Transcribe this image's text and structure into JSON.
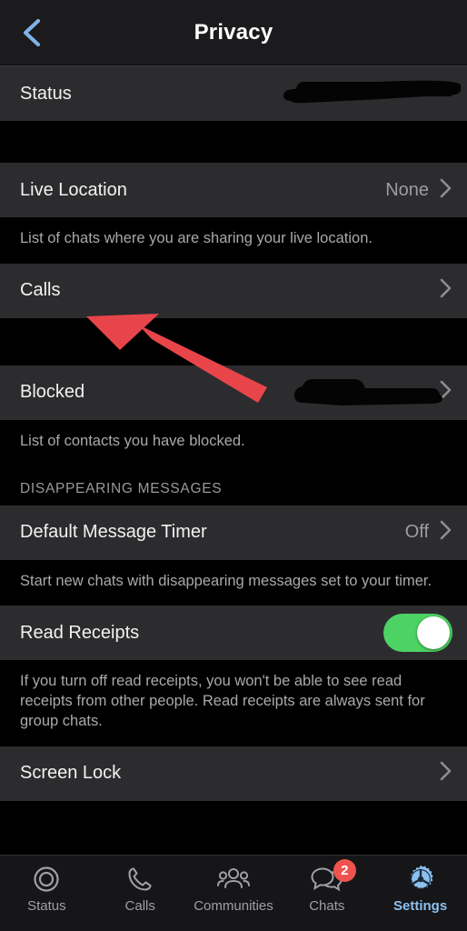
{
  "header": {
    "title": "Privacy",
    "back_icon": "chevron-left-icon",
    "accent_color": "#7fb3e8"
  },
  "colors": {
    "row_bg": "#2c2c2e",
    "page_bg": "#000000",
    "toggle_on": "#4cd364",
    "badge": "#ef5350",
    "active_tab": "#8cc0f0",
    "annotation_arrow": "#e8454b"
  },
  "sections": [
    {
      "header": null,
      "rows": [
        {
          "label": "Status",
          "value": "",
          "redacted": true,
          "chevron": false,
          "toggle": null
        }
      ],
      "footer": null
    },
    {
      "header": null,
      "rows": [
        {
          "label": "Live Location",
          "value": "None",
          "redacted": false,
          "chevron": true,
          "toggle": null
        }
      ],
      "footer": "List of chats where you are sharing your live location."
    },
    {
      "header": null,
      "rows": [
        {
          "label": "Calls",
          "value": "",
          "redacted": false,
          "chevron": true,
          "toggle": null
        }
      ],
      "footer": null
    },
    {
      "header": null,
      "rows": [
        {
          "label": "Blocked",
          "value": "",
          "redacted": true,
          "chevron": true,
          "toggle": null
        }
      ],
      "footer": "List of contacts you have blocked."
    },
    {
      "header": "DISAPPEARING MESSAGES",
      "rows": [
        {
          "label": "Default Message Timer",
          "value": "Off",
          "redacted": false,
          "chevron": true,
          "toggle": null
        }
      ],
      "footer": "Start new chats with disappearing messages set to your timer."
    },
    {
      "header": null,
      "rows": [
        {
          "label": "Read Receipts",
          "value": "",
          "redacted": false,
          "chevron": false,
          "toggle": "on"
        }
      ],
      "footer": "If you turn off read receipts, you won't be able to see read receipts from other people. Read receipts are always sent for group chats."
    },
    {
      "header": null,
      "rows": [
        {
          "label": "Screen Lock",
          "value": "",
          "redacted": false,
          "chevron": true,
          "toggle": null
        }
      ],
      "footer": null
    }
  ],
  "rows": {
    "status": {
      "label": "Status"
    },
    "live_location": {
      "label": "Live Location",
      "value": "None"
    },
    "calls": {
      "label": "Calls"
    },
    "blocked": {
      "label": "Blocked"
    },
    "default_message_timer": {
      "label": "Default Message Timer",
      "value": "Off"
    },
    "read_receipts": {
      "label": "Read Receipts"
    },
    "screen_lock": {
      "label": "Screen Lock"
    }
  },
  "section_headers": {
    "disappearing_messages": "DISAPPEARING MESSAGES"
  },
  "footers": {
    "live_location": "List of chats where you are sharing your live location.",
    "blocked": "List of contacts you have blocked.",
    "default_message_timer": "Start new chats with disappearing messages set to your timer.",
    "read_receipts": "If you turn off read receipts, you won't be able to see read receipts from other people. Read receipts are always sent for group chats."
  },
  "annotation": {
    "type": "arrow",
    "points_at": "Calls",
    "color": "#e8454b"
  },
  "tab_bar": {
    "tabs": [
      {
        "label": "Status",
        "icon": "status-rings-icon",
        "active": false,
        "badge": null
      },
      {
        "label": "Calls",
        "icon": "phone-icon",
        "active": false,
        "badge": null
      },
      {
        "label": "Communities",
        "icon": "communities-icon",
        "active": false,
        "badge": null
      },
      {
        "label": "Chats",
        "icon": "chat-bubbles-icon",
        "active": false,
        "badge": "2"
      },
      {
        "label": "Settings",
        "icon": "gear-icon",
        "active": true,
        "badge": null
      }
    ]
  }
}
